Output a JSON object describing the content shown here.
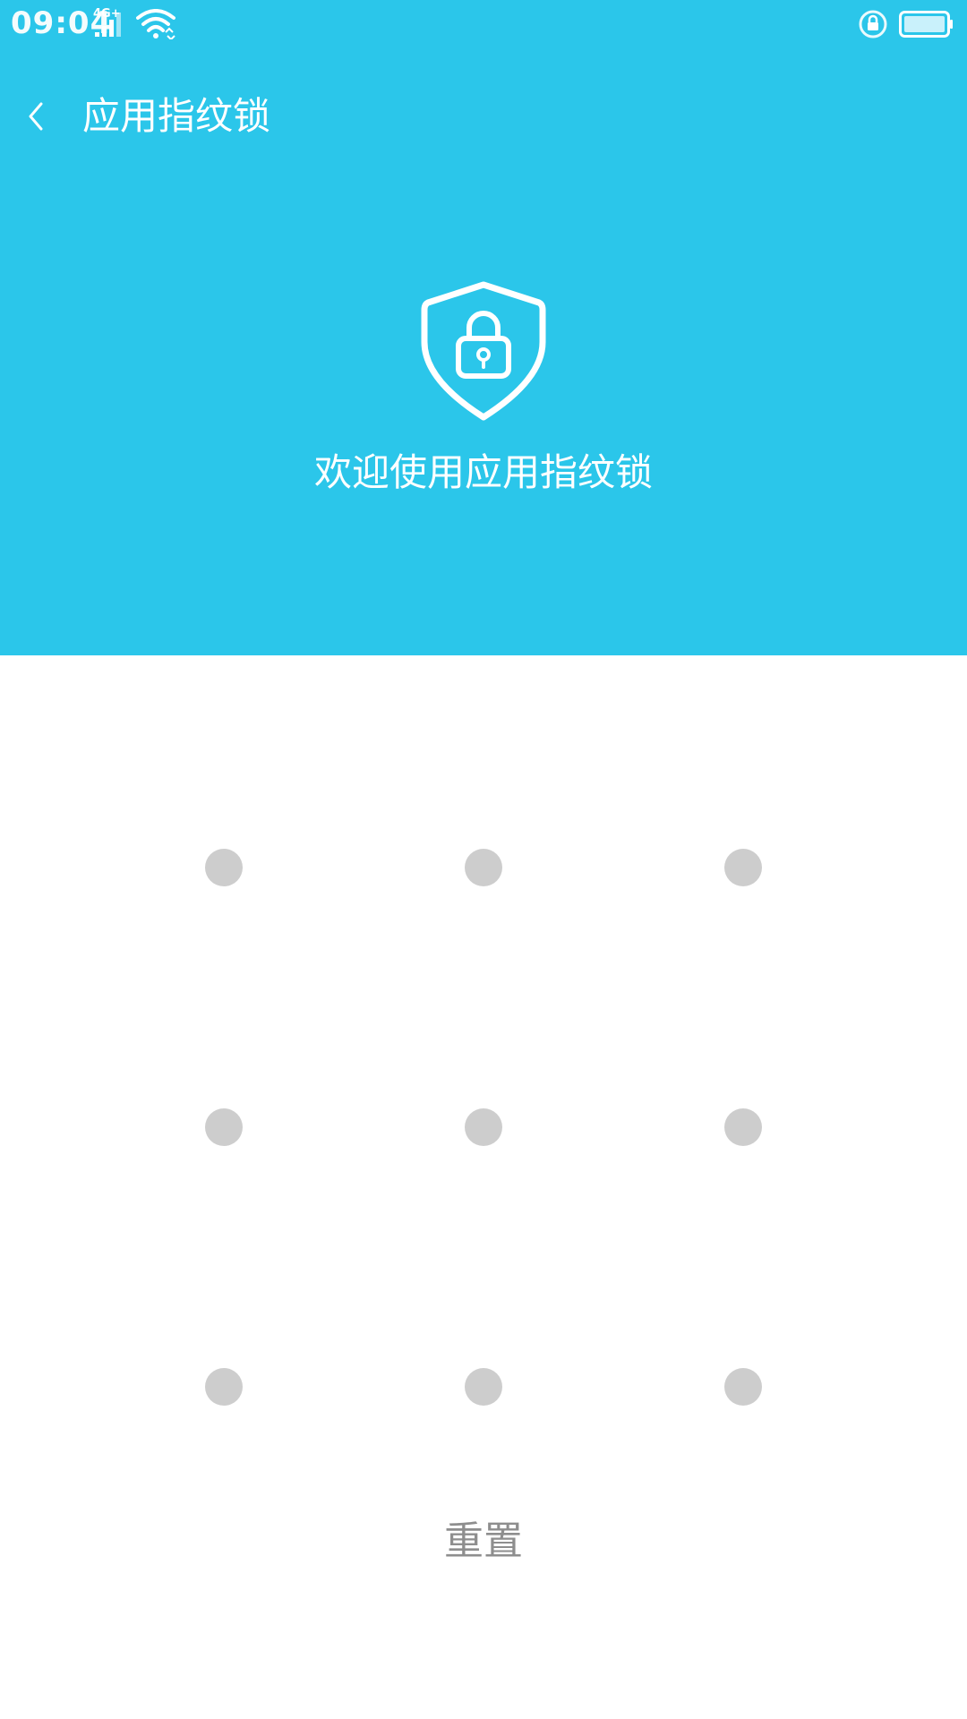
{
  "status_bar": {
    "time": "09:04",
    "network": "4G+"
  },
  "app_bar": {
    "title": "应用指纹锁"
  },
  "hero": {
    "welcome_text": "欢迎使用应用指纹锁"
  },
  "pattern": {
    "rows": 3,
    "cols": 3
  },
  "actions": {
    "reset_label": "重置"
  },
  "colors": {
    "header_bg": "#2bc6ea",
    "dot": "#cdcdcd",
    "reset_text": "#8e8e8e"
  },
  "icons": {
    "back": "chevron-left-icon",
    "shield": "shield-lock-icon",
    "signal": "signal-icon",
    "wifi": "wifi-icon",
    "rotation_lock": "rotation-lock-icon",
    "battery": "battery-icon"
  }
}
